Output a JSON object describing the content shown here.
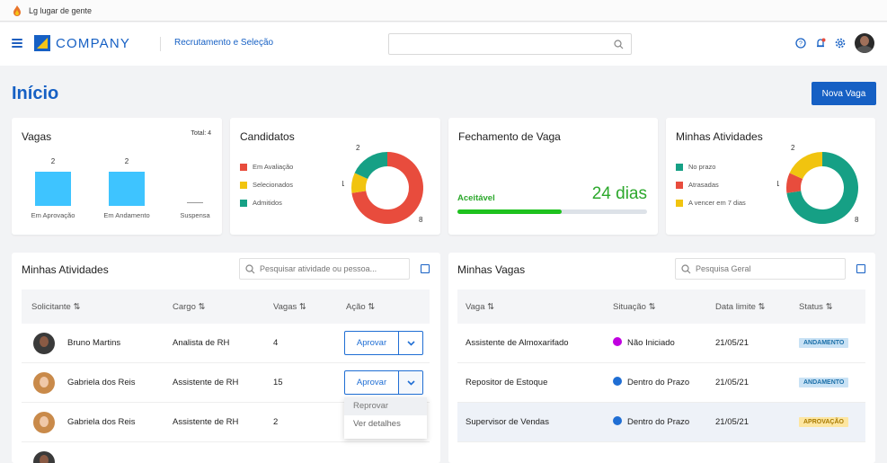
{
  "browser": {
    "tab_title": "Lg lugar de gente"
  },
  "header": {
    "brand": "COMPANY",
    "module": "Recrutamento e Seleção",
    "search_placeholder": ""
  },
  "page": {
    "title": "Início",
    "new_job_button": "Nova Vaga"
  },
  "colors": {
    "primary": "#1660c4",
    "bar": "#3ec4ff",
    "red": "#e84c3d",
    "yellow": "#f1c40f",
    "teal": "#16a085",
    "green": "#2ecc40"
  },
  "vagas_card": {
    "title": "Vagas",
    "total": "Total: 4",
    "chart_data": {
      "type": "bar",
      "categories": [
        "Em Aprovação",
        "Em Andamento",
        "Suspensa"
      ],
      "values": [
        2,
        2,
        0
      ],
      "value_labels": [
        "2",
        "2",
        "—"
      ],
      "ylim": [
        0,
        2
      ]
    }
  },
  "candidatos_card": {
    "title": "Candidatos",
    "legend": [
      "Em Avaliação",
      "Selecionados",
      "Admitidos"
    ],
    "chart_data": {
      "type": "pie",
      "labels": [
        "Em Avaliação",
        "Selecionados",
        "Admitidos"
      ],
      "values": [
        8,
        1,
        2
      ],
      "colors": [
        "#e84c3d",
        "#f1c40f",
        "#16a085"
      ]
    },
    "value_labels": [
      "8",
      "1",
      "2"
    ]
  },
  "fechamento_card": {
    "title": "Fechamento de Vaga",
    "status": "Aceitável",
    "days": "24 dias",
    "progress": 0.55
  },
  "atividades_card": {
    "title": "Minhas Atividades",
    "legend": [
      "No prazo",
      "Atrasadas",
      "A vencer em 7 dias"
    ],
    "chart_data": {
      "type": "pie",
      "labels": [
        "No prazo",
        "Atrasadas",
        "A vencer em 7 dias"
      ],
      "values": [
        8,
        1,
        2
      ],
      "colors": [
        "#16a085",
        "#e84c3d",
        "#f1c40f"
      ]
    },
    "value_labels": [
      "8",
      "1",
      "2"
    ]
  },
  "atividades_panel": {
    "title": "Minhas Atividades",
    "search_placeholder": "Pesquisar atividade ou pessoa...",
    "columns": [
      "Solicitante",
      "Cargo",
      "Vagas",
      "Ação"
    ],
    "rows": [
      {
        "name": "Bruno Martins",
        "cargo": "Analista de RH",
        "vagas": "4",
        "action": "Aprovar"
      },
      {
        "name": "Gabriela dos Reis",
        "cargo": "Assistente de RH",
        "vagas": "15",
        "action": "Aprovar"
      },
      {
        "name": "Gabriela dos Reis",
        "cargo": "Assistente de RH",
        "vagas": "2",
        "action": ""
      }
    ],
    "menu": [
      "Reprovar",
      "Ver detalhes"
    ]
  },
  "vagas_panel": {
    "title": "Minhas Vagas",
    "search_placeholder": "Pesquisa Geral",
    "columns": [
      "Vaga",
      "Situação",
      "Data limite",
      "Status"
    ],
    "rows": [
      {
        "vaga": "Assistente de Almoxarifado",
        "situacao": "Não Iniciado",
        "dot": "#c000e0",
        "data": "21/05/21",
        "status": "ANDAMENTO"
      },
      {
        "vaga": "Repositor de Estoque",
        "situacao": "Dentro do Prazo",
        "dot": "#1f6ed4",
        "data": "21/05/21",
        "status": "ANDAMENTO"
      },
      {
        "vaga": "Supervisor de Vendas",
        "situacao": "Dentro do Prazo",
        "dot": "#1f6ed4",
        "data": "21/05/21",
        "status": "APROVAÇÃO"
      }
    ]
  }
}
